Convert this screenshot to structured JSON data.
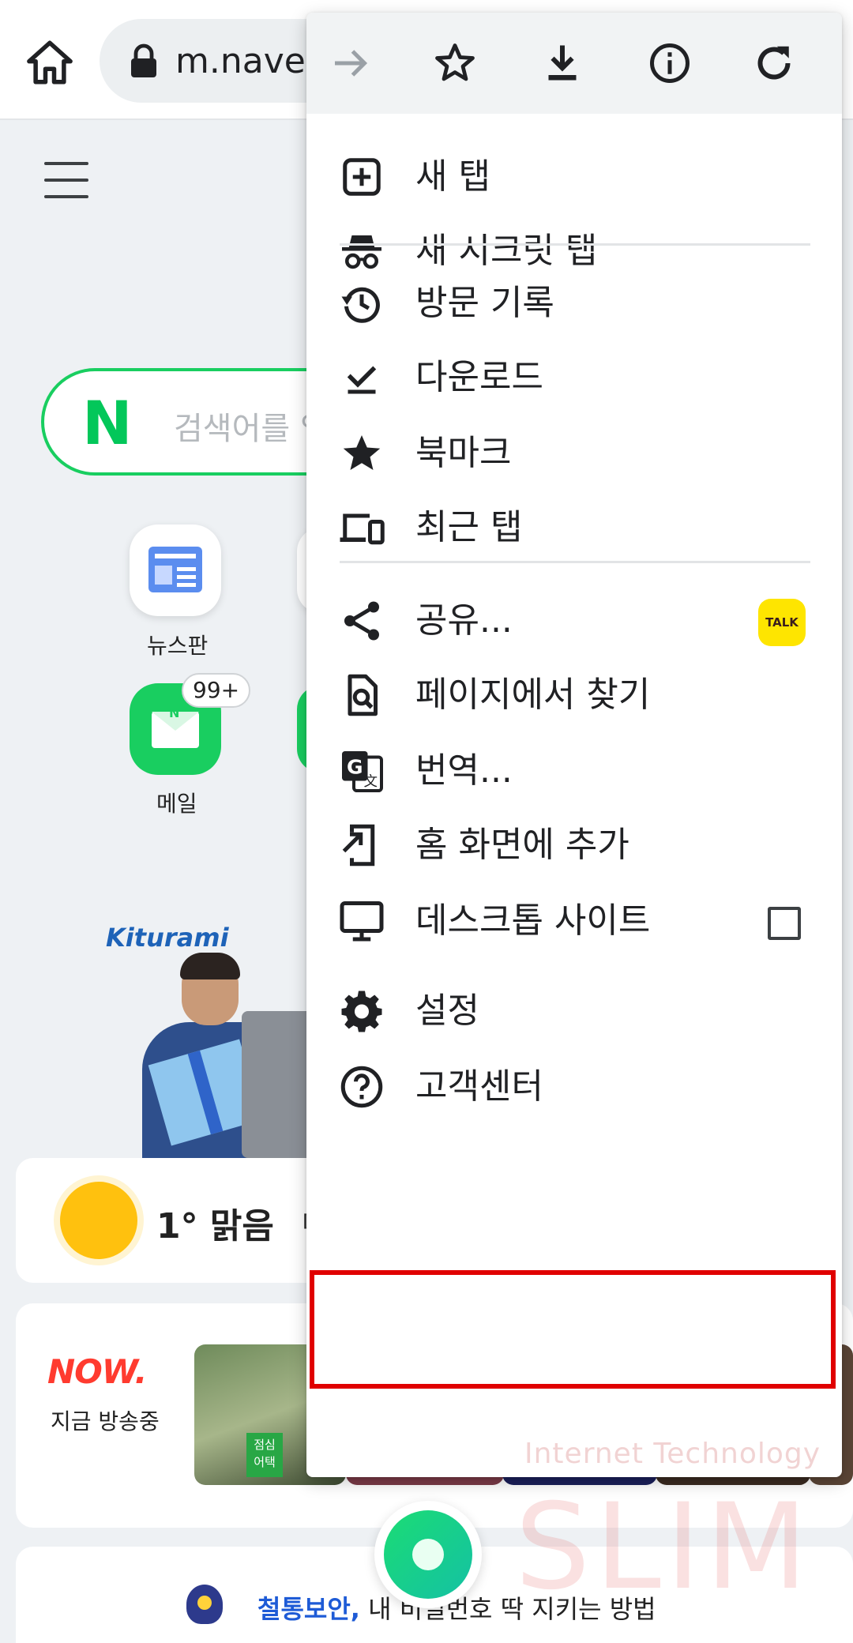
{
  "browser": {
    "url": "m.naver."
  },
  "page": {
    "search_placeholder": "검색어를 입",
    "tiles": [
      {
        "label": "뉴스판"
      },
      {
        "label": "메일",
        "badge": "99+",
        "icon_text": "N"
      }
    ],
    "ad_brand": "Kiturami",
    "weather": {
      "temp_condition": "1° 맑음",
      "more": "미세"
    },
    "now": {
      "logo": "NOW.",
      "subtitle": "지금 방송중",
      "thumb_tag": "점심 어택"
    },
    "notice": {
      "highlight": "철통보안,",
      "text": " 내 비밀번호 딱 지키는 방법"
    }
  },
  "menu": {
    "toolbar": [
      {
        "name": "forward-icon",
        "enabled": false
      },
      {
        "name": "bookmark-star-icon",
        "enabled": true
      },
      {
        "name": "download-icon",
        "enabled": true
      },
      {
        "name": "page-info-icon",
        "enabled": true
      },
      {
        "name": "reload-icon",
        "enabled": true
      }
    ],
    "items": [
      {
        "id": "new-tab",
        "label": "새 탭",
        "icon": "new-tab-icon"
      },
      {
        "id": "incognito-tab",
        "label": "새 시크릿 탭",
        "icon": "incognito-icon"
      },
      {
        "id": "history",
        "label": "방문 기록",
        "icon": "history-icon"
      },
      {
        "id": "downloads",
        "label": "다운로드",
        "icon": "download-done-icon"
      },
      {
        "id": "bookmarks",
        "label": "북마크",
        "icon": "star-icon"
      },
      {
        "id": "recent-tabs",
        "label": "최근 탭",
        "icon": "devices-icon"
      },
      {
        "id": "share",
        "label": "공유...",
        "icon": "share-icon",
        "badge": "TALK"
      },
      {
        "id": "find-in-page",
        "label": "페이지에서 찾기",
        "icon": "find-in-page-icon"
      },
      {
        "id": "translate",
        "label": "번역...",
        "icon": "translate-icon"
      },
      {
        "id": "add-to-home",
        "label": "홈 화면에 추가",
        "icon": "add-to-home-icon"
      },
      {
        "id": "desktop-site",
        "label": "데스크톱 사이트",
        "icon": "monitor-icon",
        "checked": false
      },
      {
        "id": "settings",
        "label": "설정",
        "icon": "gear-icon",
        "highlighted": true
      },
      {
        "id": "help",
        "label": "고객센터",
        "icon": "help-icon"
      }
    ]
  },
  "watermark": {
    "line1": "Internet Technology",
    "line2": "SLIM"
  },
  "colors": {
    "naver_green": "#03c75a",
    "highlight_red": "#e00000",
    "kakao_yellow": "#fee500"
  }
}
